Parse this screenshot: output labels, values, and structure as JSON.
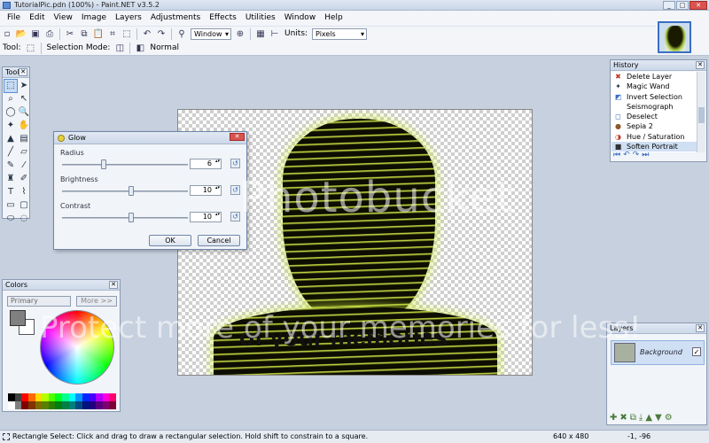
{
  "window": {
    "title": "TutorialPic.pdn (100%) - Paint.NET v3.5.2",
    "min": "_",
    "max": "□",
    "close": "✕"
  },
  "menu": [
    "File",
    "Edit",
    "View",
    "Image",
    "Layers",
    "Adjustments",
    "Effects",
    "Utilities",
    "Window",
    "Help"
  ],
  "toolbar": {
    "window_dropdown": "Window",
    "units_label": "Units:",
    "units_value": "Pixels",
    "tool_label": "Tool:",
    "selection_mode_label": "Selection Mode:",
    "blend_mode": "Normal"
  },
  "watermark": {
    "top": "Photobucket",
    "bottom": "Protect more of your memories for less!"
  },
  "image": {
    "shirt_text": "of your memories"
  },
  "tools_panel": {
    "title": "Tools",
    "close": "✕",
    "items": [
      {
        "icon": "rectangle-select",
        "glyph": "⬚"
      },
      {
        "icon": "move-selected",
        "glyph": "➤"
      },
      {
        "icon": "lasso-select",
        "glyph": "⌕"
      },
      {
        "icon": "move-selection",
        "glyph": "↖"
      },
      {
        "icon": "ellipse-select",
        "glyph": "◯"
      },
      {
        "icon": "zoom",
        "glyph": "🔍"
      },
      {
        "icon": "magic-wand",
        "glyph": "✦"
      },
      {
        "icon": "pan",
        "glyph": "✋"
      },
      {
        "icon": "paint-bucket",
        "glyph": "▲"
      },
      {
        "icon": "gradient",
        "glyph": "▤"
      },
      {
        "icon": "paintbrush",
        "glyph": "╱"
      },
      {
        "icon": "eraser",
        "glyph": "▱"
      },
      {
        "icon": "pencil",
        "glyph": "✎"
      },
      {
        "icon": "color-picker",
        "glyph": "⁄"
      },
      {
        "icon": "clone-stamp",
        "glyph": "♜"
      },
      {
        "icon": "recolor",
        "glyph": "✐"
      },
      {
        "icon": "text",
        "glyph": "T"
      },
      {
        "icon": "line-curve",
        "glyph": "⌇"
      },
      {
        "icon": "rectangle",
        "glyph": "▭"
      },
      {
        "icon": "rounded-rectangle",
        "glyph": "▢"
      },
      {
        "icon": "ellipse",
        "glyph": "⬭"
      },
      {
        "icon": "freeform-shape",
        "glyph": "◌"
      }
    ]
  },
  "glow_dialog": {
    "title": "Glow",
    "close": "✕",
    "params": [
      {
        "label": "Radius",
        "value": "6",
        "level": 0.32
      },
      {
        "label": "Brightness",
        "value": "10",
        "level": 0.55
      },
      {
        "label": "Contrast",
        "value": "10",
        "level": 0.55
      }
    ],
    "reset_glyph": "↺",
    "ok": "OK",
    "cancel": "Cancel"
  },
  "history": {
    "title": "History",
    "close": "✕",
    "items": [
      {
        "label": "Delete Layer",
        "icon": "delete-layer-icon",
        "glyph": "✖",
        "color": "#c0392b"
      },
      {
        "label": "Magic Wand",
        "icon": "magic-wand-icon",
        "glyph": "✦",
        "color": "#2c3e50"
      },
      {
        "label": "Invert Selection",
        "icon": "invert-selection-icon",
        "glyph": "◩",
        "color": "#3a6fc5"
      },
      {
        "label": "Seismograph",
        "icon": "seismograph-icon",
        "glyph": "",
        "color": "#555"
      },
      {
        "label": "Deselect",
        "icon": "deselect-icon",
        "glyph": "◻",
        "color": "#3a6fc5"
      },
      {
        "label": "Sepia 2",
        "icon": "sepia-icon",
        "glyph": "●",
        "color": "#8a5a2b"
      },
      {
        "label": "Hue / Saturation",
        "icon": "hue-saturation-icon",
        "glyph": "◑",
        "color": "#c0392b"
      },
      {
        "label": "Soften Portrait",
        "icon": "soften-portrait-icon",
        "glyph": "■",
        "color": "#333"
      }
    ],
    "selected_index": 7,
    "controls": [
      "⏮",
      "↶",
      "↷",
      "⏭"
    ]
  },
  "layers": {
    "title": "Layers",
    "close": "✕",
    "layer_name": "Background",
    "visible_check": "✓",
    "controls": [
      "✚",
      "✖",
      "⧉",
      "⤓",
      "▲",
      "▼",
      "⚙"
    ]
  },
  "colors": {
    "title": "Colors",
    "close": "✕",
    "mode": "Primary",
    "more_button": "More >>",
    "primary_color": "#808080",
    "secondary_color": "#ffffff",
    "palette": [
      "#000000",
      "#404040",
      "#ff0000",
      "#ff6a00",
      "#ffd800",
      "#b6ff00",
      "#4cff00",
      "#00ff21",
      "#00ff90",
      "#00ffff",
      "#0094ff",
      "#0026ff",
      "#4800ff",
      "#b200ff",
      "#ff00dc",
      "#ff006e",
      "#ffffff",
      "#808080",
      "#7f0000",
      "#7f3300",
      "#7f6a00",
      "#5b7f00",
      "#267f00",
      "#007f0e",
      "#007f46",
      "#007f7f",
      "#004a7f",
      "#00137f",
      "#21007f",
      "#57007f",
      "#7f006e",
      "#7f0037"
    ]
  },
  "status": {
    "message": "Rectangle Select: Click and drag to draw a rectangular selection. Hold shift to constrain to a square.",
    "image_size": "640 x 480",
    "cursor": "-1, -96"
  }
}
